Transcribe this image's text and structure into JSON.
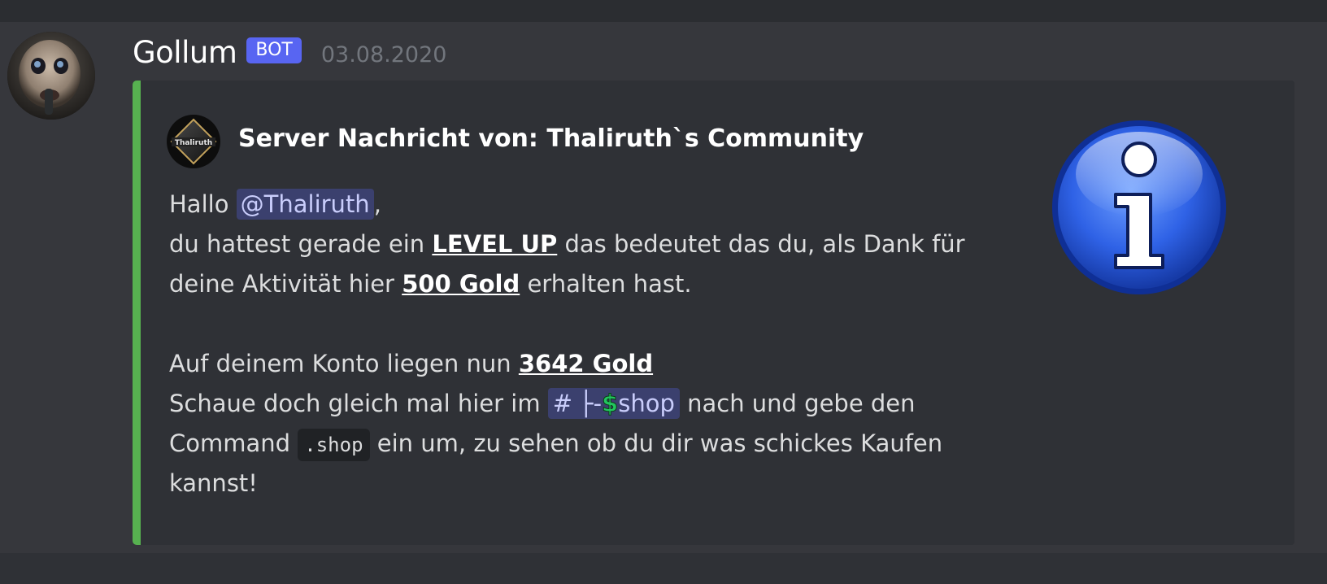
{
  "message": {
    "username": "Gollum",
    "bot_tag": "BOT",
    "timestamp": "03.08.2020",
    "avatar": "gollum-avatar"
  },
  "embed": {
    "accent_color": "#57b150",
    "author": {
      "name": "Server Nachricht von: Thaliruth`s Community",
      "icon": "server-icon"
    },
    "description": {
      "line1_prefix": "Hallo ",
      "mention": "@Thaliruth",
      "line1_suffix": ",",
      "line2_prefix": "du hattest gerade ein ",
      "line2_bold": "LEVEL UP",
      "line2_suffix": " das bedeutet das du, als Dank für",
      "line3_prefix": "deine Aktivität hier ",
      "line3_bold": "500 Gold",
      "line3_suffix": " erhalten hast.",
      "line4_prefix": "Auf deinem Konto liegen nun ",
      "line4_bold": "3642 Gold",
      "line5_prefix": "Schaue doch gleich mal hier im ",
      "channel_hash": "#",
      "channel_prefix": "├-",
      "channel_emoji": "$",
      "channel_name": "shop",
      "line5_suffix": " nach und gebe den",
      "line6_prefix": "Command ",
      "code": ".shop",
      "line6_suffix": " ein um, zu sehen ob du dir was schickes Kaufen",
      "line7": "kannst!"
    },
    "thumbnail": "info-icon"
  },
  "colors": {
    "background": "#36373c",
    "embed_background": "#2f3136",
    "bot_tag": "#5865f2",
    "mention": "#c9cdfb"
  }
}
